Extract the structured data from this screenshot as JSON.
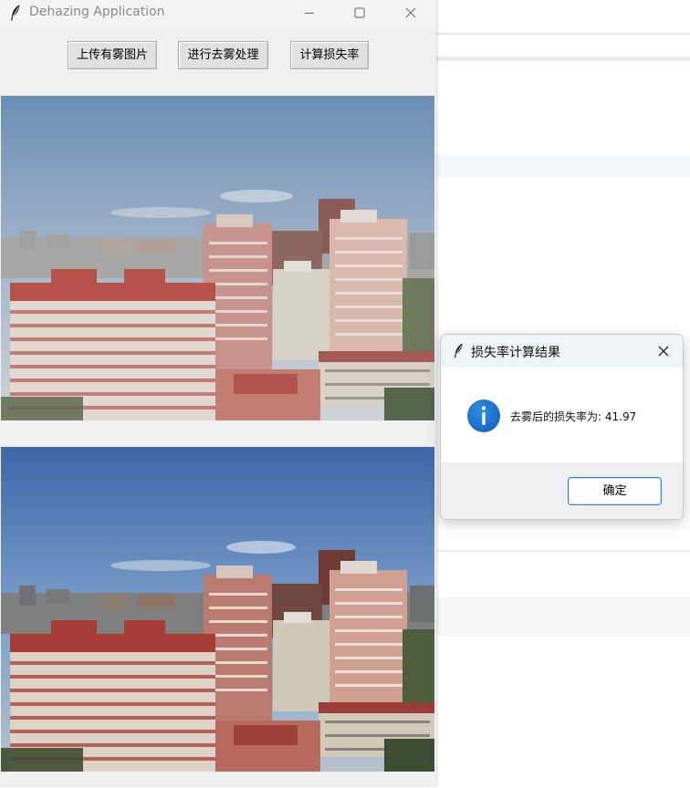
{
  "app_window": {
    "title": "Dehazing Application",
    "buttons": {
      "upload": "上传有雾图片",
      "dehaze": "进行去雾处理",
      "loss": "计算损失率"
    }
  },
  "images": {
    "original": "hazy-cityscape-photo",
    "result": "dehazed-cityscape-photo"
  },
  "dialog": {
    "title": "损失率计算结果",
    "message": "去雾后的损失率为: 41.97",
    "ok_label": "确定",
    "icon": "info-icon"
  },
  "colors": {
    "info_blue": "#1976d2",
    "button_focus": "#3c7fd0"
  }
}
